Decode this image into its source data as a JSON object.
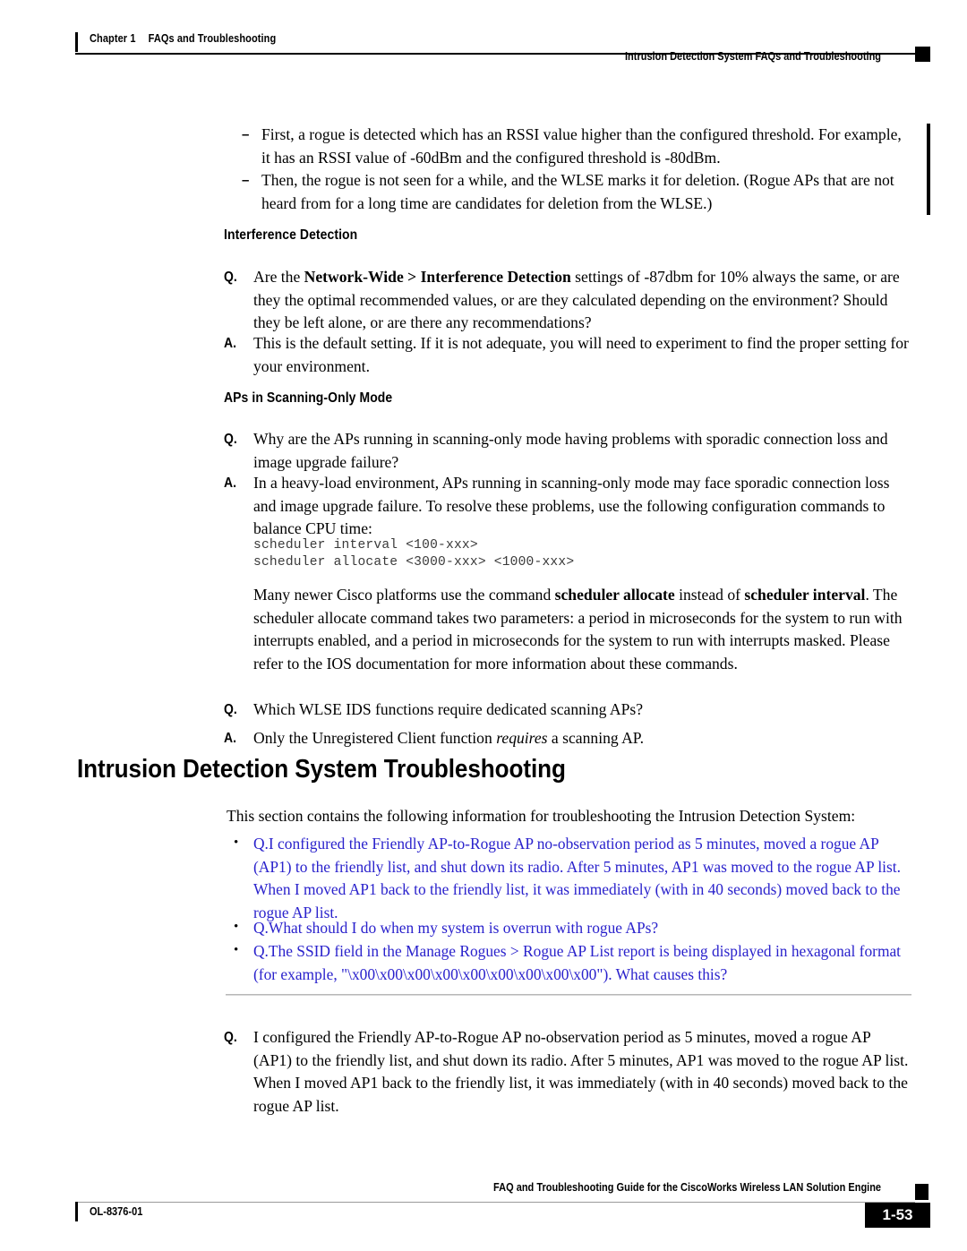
{
  "header": {
    "chapter_label": "Chapter 1",
    "chapter_title": "FAQs and Troubleshooting",
    "running_head": "Intrusion Detection System FAQs and Troubleshooting"
  },
  "body": {
    "dash_items": [
      "First, a rogue is detected which has an RSSI value higher than the configured threshold. For example, it has an RSSI value of -60dBm and the configured threshold is -80dBm.",
      "Then, the rogue is not seen for a while, and the WLSE marks it for deletion. (Rogue APs that are not heard from for a long time are candidates for deletion from the WLSE.)"
    ],
    "dash_marker": "–",
    "heading_interference": "Interference Detection",
    "heading_scanning": "APs in Scanning-Only Mode",
    "q_label": "Q.",
    "a_label": "A.",
    "qa1_q_pre": "Are the ",
    "qa1_q_bold": "Network-Wide > Interference Detection",
    "qa1_q_post": " settings of -87dbm for 10% always the same, or are they the optimal recommended values, or are they calculated depending on the environment? Should they be left alone, or are there any recommendations?",
    "qa1_a": "This is the default setting. If it is not adequate, you will need to experiment to find the proper setting for your environment.",
    "qa2_q": "Why are the APs running in scanning-only mode having problems with sporadic connection loss and image upgrade failure?",
    "qa2_a": "In a heavy-load environment, APs running in scanning-only mode may face sporadic connection loss and image upgrade failure. To resolve these problems, use the following configuration commands to balance CPU time:",
    "code_block": "scheduler interval <100-xxx>\nscheduler allocate <3000-xxx> <1000-xxx>",
    "para_pre": "Many newer Cisco platforms use the command ",
    "para_bold1": "scheduler allocate",
    "para_mid": " instead of ",
    "para_bold2": "scheduler interval",
    "para_post": ". The scheduler allocate command takes two parameters: a period in microseconds for the system to run with interrupts enabled, and a period in microseconds for the system to run with interrupts masked. Please refer to the IOS documentation for more information about these commands.",
    "qa3_q": "Which WLSE IDS functions require dedicated scanning APs?",
    "qa3_a_pre": "Only the Unregistered Client function ",
    "qa3_a_ital": "requires",
    "qa3_a_post": " a scanning AP."
  },
  "section": {
    "title": "Intrusion Detection System Troubleshooting",
    "intro": "This section contains the following information for troubleshooting the Intrusion Detection System:",
    "bullet": "•",
    "links": [
      "Q.I configured the Friendly AP-to-Rogue AP no-observation period as 5 minutes, moved a rogue AP (AP1) to the friendly list, and shut down its radio. After 5 minutes, AP1 was moved to the rogue AP list. When I moved AP1 back to the friendly list, it was immediately (with in 40 seconds) moved back to the rogue AP list.",
      "Q.What should I do when my system is overrun with rogue APs?",
      "Q.The SSID field in the Manage Rogues > Rogue AP List report is being displayed in hexagonal format (for example, \"\\x00\\x00\\x00\\x00\\x00\\x00\\x00\\x00\\x00\"). What causes this?"
    ],
    "final_qa_q": "I configured the Friendly AP-to-Rogue AP no-observation period as 5 minutes, moved a rogue AP (AP1) to the friendly list, and shut down its radio. After 5 minutes, AP1 was moved to the rogue AP list. When I moved AP1 back to the friendly list, it was immediately (with in 40 seconds) moved back to the rogue AP list."
  },
  "footer": {
    "doc_id": "OL-8376-01",
    "guide_title": "FAQ and Troubleshooting Guide for the CiscoWorks Wireless LAN Solution Engine",
    "page_number": "1-53"
  },
  "colors": {
    "link": "#2a22cc",
    "rule": "#b8b8b8",
    "ink": "#000000"
  }
}
